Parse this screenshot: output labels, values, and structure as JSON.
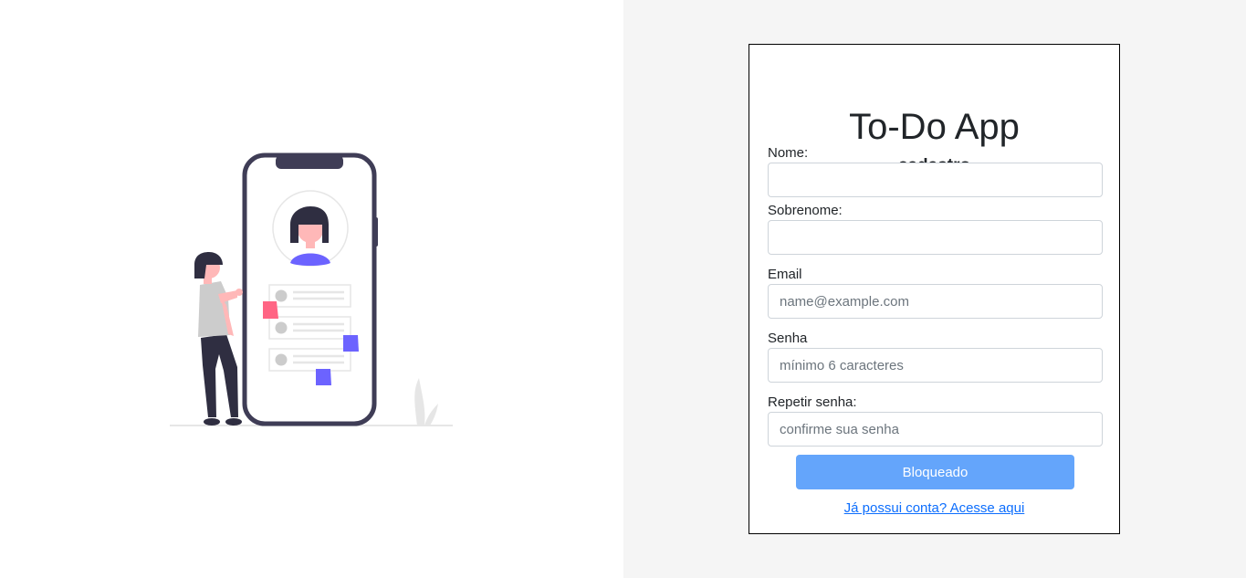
{
  "app": {
    "title": "To-Do App",
    "subtitle": "cadastro"
  },
  "form": {
    "nome": {
      "label": "Nome:",
      "value": "",
      "placeholder": ""
    },
    "sobrenome": {
      "label": "Sobrenome:",
      "value": "",
      "placeholder": ""
    },
    "email": {
      "label": "Email",
      "value": "",
      "placeholder": "name@example.com"
    },
    "senha": {
      "label": "Senha",
      "value": "",
      "placeholder": "mínimo 6 caracteres"
    },
    "repetir_senha": {
      "label": "Repetir senha:",
      "value": "",
      "placeholder": "confirme sua senha"
    },
    "submit_label": "Bloqueado",
    "login_link": "Já possui conta? Acesse aqui"
  },
  "illustration": {
    "icon": "phone-user-illustration"
  },
  "colors": {
    "accent": "#64a5fb",
    "link": "#0d6efd",
    "phone_frame": "#3f3d56",
    "purple": "#6c63ff",
    "pink": "#ff6584",
    "right_bg": "#f5f5f5"
  }
}
